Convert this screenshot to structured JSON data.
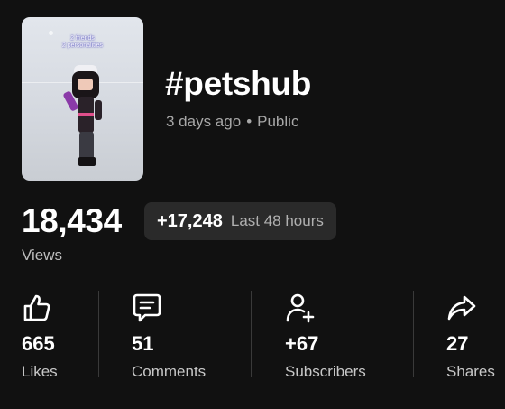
{
  "video": {
    "thumbnail_caption_line1": "2 friends",
    "thumbnail_caption_line2": "2 personalities",
    "title": "#petshub",
    "age": "3 days ago",
    "separator": "•",
    "visibility": "Public"
  },
  "views": {
    "count": "18,434",
    "delta": "+17,248",
    "period": "Last 48 hours",
    "label": "Views"
  },
  "stats": [
    {
      "icon": "thumbs-up-icon",
      "value": "665",
      "label": "Likes"
    },
    {
      "icon": "comment-icon",
      "value": "51",
      "label": "Comments"
    },
    {
      "icon": "add-user-icon",
      "value": "+67",
      "label": "Subscribers"
    },
    {
      "icon": "share-icon",
      "value": "27",
      "label": "Shares"
    }
  ],
  "colors": {
    "background": "#111111",
    "pill_background": "#2a2a2a",
    "secondary_text": "#a8a8a8"
  }
}
